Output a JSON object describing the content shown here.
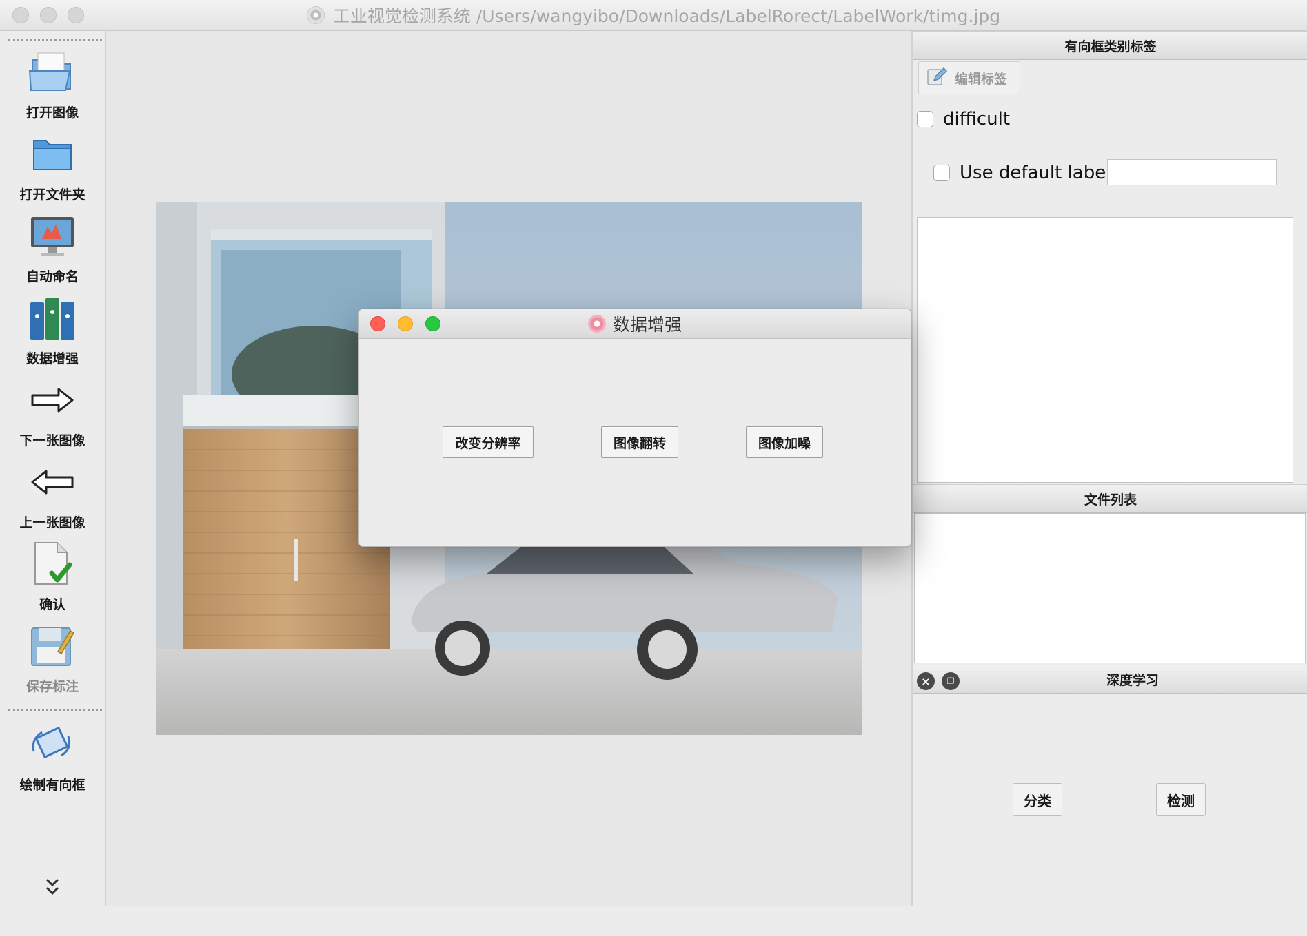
{
  "window": {
    "title": "工业视觉检测系统 /Users/wangyibo/Downloads/LabelRorect/LabelWork/timg.jpg"
  },
  "toolbar": {
    "items": [
      {
        "label": "打开图像",
        "icon": "open-image-icon"
      },
      {
        "label": "打开文件夹",
        "icon": "open-folder-icon"
      },
      {
        "label": "自动命名",
        "icon": "auto-name-icon"
      },
      {
        "label": "数据增强",
        "icon": "data-augment-icon"
      },
      {
        "label": "下一张图像",
        "icon": "next-arrow-icon"
      },
      {
        "label": "上一张图像",
        "icon": "prev-arrow-icon"
      },
      {
        "label": "确认",
        "icon": "confirm-icon"
      },
      {
        "label": "保存标注",
        "icon": "save-icon",
        "disabled": true
      },
      {
        "label": "绘制有向框",
        "icon": "draw-rotated-box-icon"
      }
    ]
  },
  "dock": {
    "label_panel": {
      "title": "有向框类别标签",
      "edit_button": "编辑标签",
      "difficult_label": "difficult",
      "difficult_checked": false,
      "use_default_label": "Use default label",
      "use_default_checked": false,
      "default_label_value": ""
    },
    "file_panel": {
      "title": "文件列表"
    },
    "dl_panel": {
      "title": "深度学习",
      "classify_button": "分类",
      "detect_button": "检测"
    }
  },
  "dialog": {
    "title": "数据增强",
    "buttons": [
      "改变分辨率",
      "图像翻转",
      "图像加噪"
    ]
  },
  "colors": {
    "close": "#fe5f57",
    "minimize": "#febc2e",
    "maximize": "#28c840"
  }
}
